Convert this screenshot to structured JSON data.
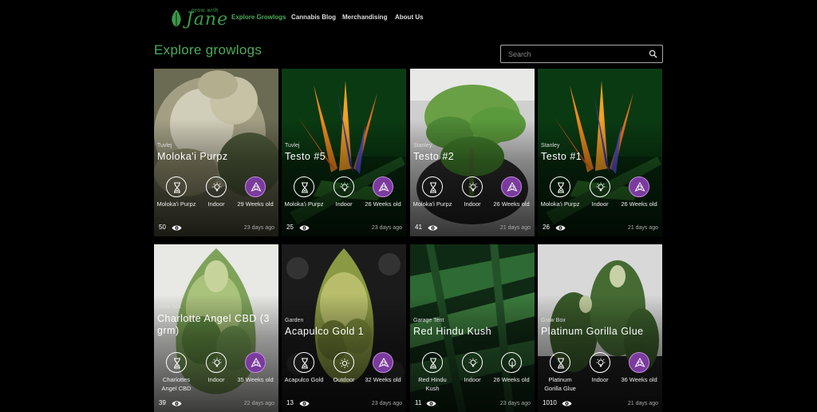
{
  "logo": {
    "small": "grow with",
    "big": "Jane"
  },
  "nav": {
    "items": [
      {
        "label": "Explore Growlogs",
        "active": true
      },
      {
        "label": "Cannabis Blog",
        "active": false
      },
      {
        "label": "Merchandising",
        "active": false
      },
      {
        "label": "About Us",
        "active": false
      }
    ]
  },
  "page": {
    "title": "Explore growlogs"
  },
  "search": {
    "placeholder": "Search",
    "icon": "search-icon"
  },
  "cards": [
    {
      "location": "Tuvlej",
      "name": "Moloka'i Purpz",
      "strain": "Moloka'i Purpz",
      "environment": "Indoor",
      "age": "29 Weeks old",
      "age_icon": "purple-cannabis-icon",
      "views": "50",
      "updated": "23 days ago",
      "image": "frosty-bud"
    },
    {
      "location": "Tuvlej",
      "name": "Testo #5",
      "strain": "Moloka'i Purpz",
      "environment": "Indoor",
      "age": "26 Weeks old",
      "age_icon": "purple-cannabis-icon",
      "views": "25",
      "updated": "23 days ago",
      "image": "bird-of-paradise"
    },
    {
      "location": "Stanley",
      "name": "Testo #2",
      "strain": "Moloka'i Purpz",
      "environment": "Indoor",
      "age": "26 Weeks old",
      "age_icon": "purple-cannabis-icon",
      "views": "41",
      "updated": "21 days ago",
      "image": "potted-plant"
    },
    {
      "location": "Stanley",
      "name": "Testo #1",
      "strain": "Moloka'i Purpz",
      "environment": "Indoor",
      "age": "26 Weeks old",
      "age_icon": "purple-cannabis-icon",
      "views": "26",
      "updated": "21 days ago",
      "image": "bird-of-paradise"
    },
    {
      "location": "Grow box",
      "name": "Charlotte Angel CBD (3 grm)",
      "strain": "Charlottes Angel CBD",
      "environment": "Indoor",
      "age": "35 Weeks old",
      "age_icon": "purple-cannabis-icon",
      "views": "39",
      "updated": "22 days ago",
      "image": "bud-white"
    },
    {
      "location": "Garden",
      "name": "Acapulco Gold 1",
      "strain": "Acapulco Gold",
      "environment": "Outdoor",
      "age": "32 Weeks old",
      "age_icon": "purple-cannabis-icon",
      "views": "13",
      "updated": "23 days ago",
      "image": "bud-pattern"
    },
    {
      "location": "Garage Tent",
      "name": "Red Hindu Kush",
      "strain": "Red Hindu Kush",
      "environment": "Indoor",
      "age": "26 Weeks old",
      "age_icon": "green-tree-icon",
      "views": "11",
      "updated": "23 days ago",
      "image": "fern"
    },
    {
      "location": "Grow Box",
      "name": "Platinum Gorilla Glue",
      "strain": "Platinum Gorilla Glue",
      "environment": "Indoor",
      "age": "36 Weeks old",
      "age_icon": "purple-cannabis-icon",
      "views": "1010",
      "updated": "21 days ago",
      "image": "room-plants"
    }
  ],
  "colors": {
    "accent": "#4cab5a",
    "purple": "#7b3b9e",
    "background": "#000000"
  }
}
